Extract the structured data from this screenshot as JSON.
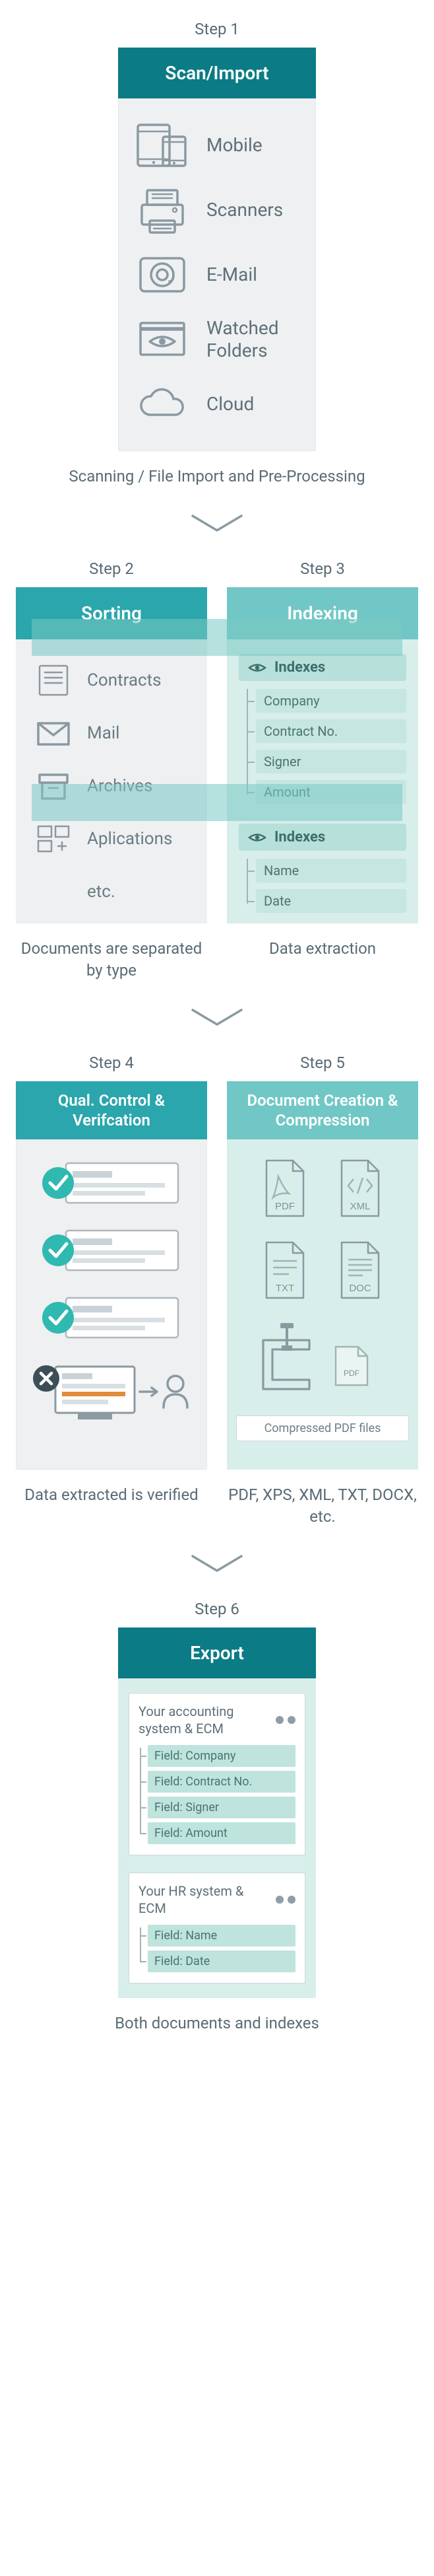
{
  "colors": {
    "teal_dark": "#0b7b85",
    "teal_mid": "#2aa6ac",
    "teal_light": "#71c7c6",
    "panel_bg": "#eef0f2",
    "mint_bg": "#d8eeea",
    "text": "#5a6b75",
    "accent_check": "#2fb9b0",
    "accent_error": "#3e4e57",
    "orange": "#e28a3e"
  },
  "step1": {
    "label": "Step 1",
    "title": "Scan/Import",
    "items": [
      {
        "icon": "mobile-icon",
        "label": "Mobile"
      },
      {
        "icon": "scanner-icon",
        "label": "Scanners"
      },
      {
        "icon": "email-icon",
        "label": "E-Mail"
      },
      {
        "icon": "watched-folders-icon",
        "label": "Watched Folders"
      },
      {
        "icon": "cloud-icon",
        "label": "Cloud"
      }
    ],
    "caption": "Scanning / File Import and Pre-Processing"
  },
  "step2": {
    "label": "Step 2",
    "title": "Sorting",
    "items": [
      {
        "icon": "contracts-icon",
        "label": "Contracts"
      },
      {
        "icon": "mail-icon",
        "label": "Mail"
      },
      {
        "icon": "archives-icon",
        "label": "Archives"
      },
      {
        "icon": "applications-icon",
        "label": "Aplications"
      },
      {
        "icon": "",
        "label": "etc."
      }
    ],
    "caption": "Documents are separated by type"
  },
  "step3": {
    "label": "Step 3",
    "title": "Indexing",
    "groups": [
      {
        "title": "Indexes",
        "items": [
          "Company",
          "Contract No.",
          "Signer",
          "Amount"
        ]
      },
      {
        "title": "Indexes",
        "items": [
          "Name",
          "Date"
        ]
      }
    ],
    "caption": "Data extraction"
  },
  "step4": {
    "label": "Step 4",
    "title": "Qual. Control & Verifcation",
    "caption": "Data extracted is verified"
  },
  "step5": {
    "label": "Step 5",
    "title": "Document Creation & Compression",
    "files": [
      "PDF",
      "XML",
      "TXT",
      "DOC"
    ],
    "chip": "Compressed PDF files",
    "caption": "PDF, XPS, XML, TXT, DOCX, etc."
  },
  "step6": {
    "label": "Step 6",
    "title": "Export",
    "cards": [
      {
        "title": "Your accounting system & ECM",
        "fields": [
          "Field: Company",
          "Field: Contract No.",
          "Field: Signer",
          "Field: Amount"
        ]
      },
      {
        "title": "Your HR system & ECM",
        "fields": [
          "Field: Name",
          "Field: Date"
        ]
      }
    ],
    "caption": "Both documents and indexes"
  }
}
